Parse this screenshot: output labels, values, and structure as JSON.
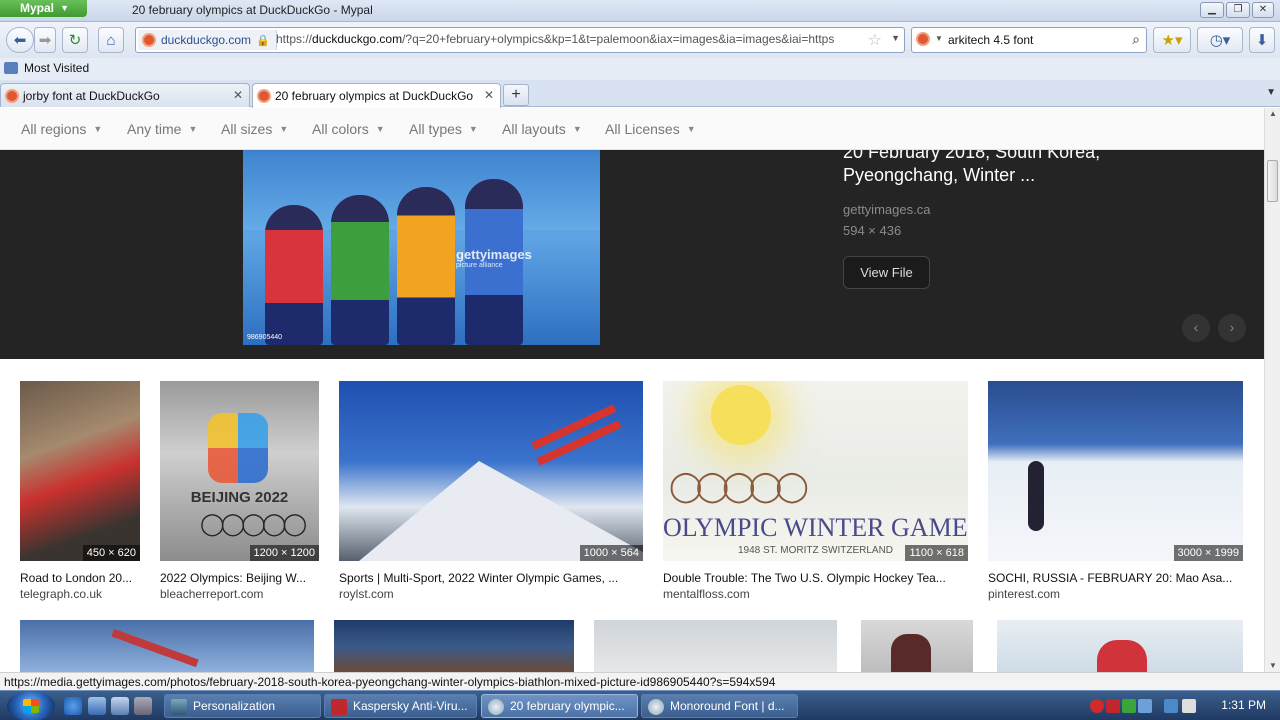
{
  "window": {
    "app_menu": "Mypal",
    "title": "20 february olympics at DuckDuckGo - Mypal",
    "buttons": [
      "minimize",
      "maximize",
      "close"
    ]
  },
  "nav": {
    "url_identity": "duckduckgo.com",
    "url_prefix": "https://",
    "url_host": "duckduckgo.com",
    "url_rest": "/?q=20+february+olympics&kp=1&t=palemoon&iax=images&ia=images&iai=https",
    "search_value": "arkitech 4.5 font"
  },
  "bookmarks": {
    "most_visited": "Most Visited"
  },
  "tabs": [
    {
      "label": "jorby font at DuckDuckGo",
      "active": false
    },
    {
      "label": "20 february olympics at DuckDuckGo",
      "active": true
    }
  ],
  "filters": [
    "All regions",
    "Any time",
    "All sizes",
    "All colors",
    "All types",
    "All layouts",
    "All Licenses"
  ],
  "detail": {
    "title": "20 February 2018, South Korea, Pyeongchang, Winter ...",
    "source": "gettyimages.ca",
    "dims": "594 × 436",
    "view_file": "View File",
    "watermark": "gettyimages",
    "watermark_sub": "picture alliance",
    "image_id": "986905440"
  },
  "results": [
    {
      "title": "Road to London 20...",
      "source": "telegraph.co.uk",
      "dims": "450 × 620"
    },
    {
      "title": "2022 Olympics: Beijing W...",
      "source": "bleacherreport.com",
      "dims": "1200 × 1200"
    },
    {
      "title": "Sports | Multi-Sport, 2022 Winter Olympic Games, ...",
      "source": "roylst.com",
      "dims": "1000 × 564"
    },
    {
      "title": "Double Trouble: The Two U.S. Olympic Hockey Tea...",
      "source": "mentalfloss.com",
      "dims": "1100 × 618"
    },
    {
      "title": "SOCHI, RUSSIA - FEBRUARY 20: Mao Asa...",
      "source": "pinterest.com",
      "dims": "3000 × 1999"
    }
  ],
  "thumb_text": {
    "beijing": "BEIJING 2022",
    "olympic_games": "OLYMPIC WINTER GAMES",
    "st_moritz": "1948 ST. MORITZ SWITZERLAND"
  },
  "status": "https://media.gettyimages.com/photos/february-2018-south-korea-pyeongchang-winter-olympics-biathlon-mixed-picture-id986905440?s=594x594",
  "taskbar": {
    "tasks": [
      {
        "label": "Personalization",
        "active": false
      },
      {
        "label": "Kaspersky Anti-Viru...",
        "active": false
      },
      {
        "label": "20 february olympic...",
        "active": true
      },
      {
        "label": "Monoround Font | d...",
        "active": false
      }
    ],
    "clock": "1:31 PM"
  },
  "colors": {
    "app_menu": "#4cae3c",
    "detail_bg": "#242424",
    "ddg_orange": "#de5833"
  }
}
